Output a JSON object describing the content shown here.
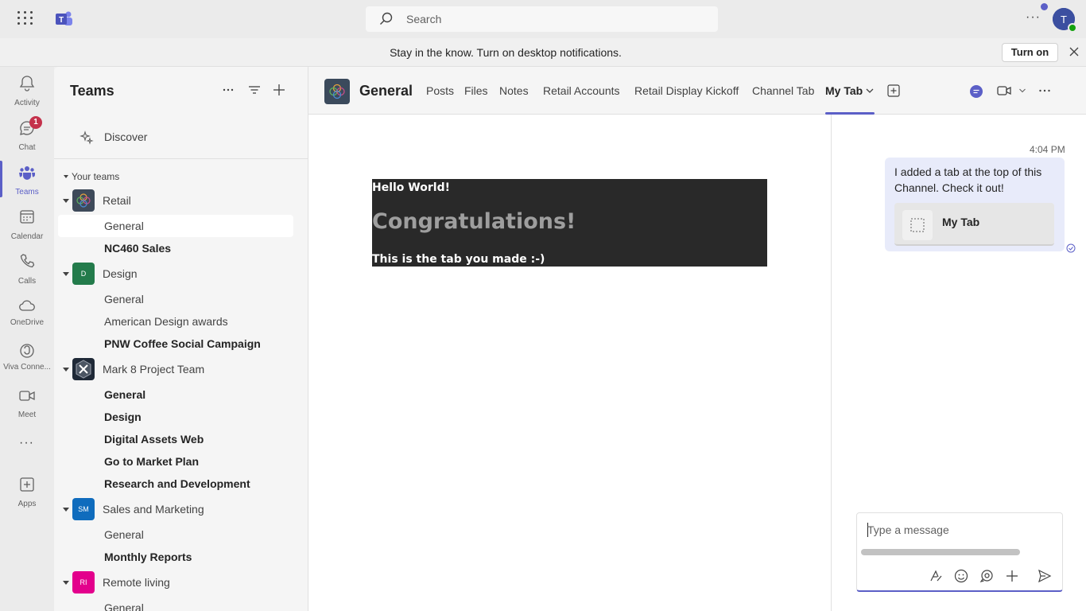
{
  "topbar": {
    "search_placeholder": "Search"
  },
  "banner": {
    "message": "Stay in the know. Turn on desktop notifications.",
    "turn_on_label": "Turn on"
  },
  "rail": {
    "items": [
      {
        "label": "Activity",
        "icon": "bell-icon"
      },
      {
        "label": "Chat",
        "icon": "chat-icon",
        "badge": "1"
      },
      {
        "label": "Teams",
        "icon": "teams-icon",
        "active": true
      },
      {
        "label": "Calendar",
        "icon": "calendar-icon"
      },
      {
        "label": "Calls",
        "icon": "phone-icon"
      },
      {
        "label": "OneDrive",
        "icon": "cloud-icon"
      },
      {
        "label": "Viva Conne...",
        "icon": "viva-connections-icon"
      },
      {
        "label": "Meet",
        "icon": "video-icon"
      },
      {
        "label": "Apps",
        "icon": "add-app-icon"
      }
    ]
  },
  "panel": {
    "title": "Teams",
    "discover": "Discover",
    "section": "Your teams",
    "teams": [
      {
        "name": "Retail",
        "avatar": "",
        "color": "#4a5568",
        "channels": [
          {
            "name": "General",
            "bold": false,
            "selected": true
          },
          {
            "name": "NC460 Sales",
            "bold": true
          }
        ]
      },
      {
        "name": "Design",
        "avatar": "D",
        "color": "#237b4b",
        "channels": [
          {
            "name": "General",
            "bold": false
          },
          {
            "name": "American Design awards",
            "bold": false
          },
          {
            "name": "PNW Coffee Social Campaign",
            "bold": true
          }
        ]
      },
      {
        "name": "Mark 8 Project Team",
        "avatar": "",
        "color": "#1f2937",
        "channels": [
          {
            "name": "General",
            "bold": true
          },
          {
            "name": "Design",
            "bold": true
          },
          {
            "name": "Digital Assets Web",
            "bold": true
          },
          {
            "name": "Go to Market Plan",
            "bold": true
          },
          {
            "name": "Research and Development",
            "bold": true
          }
        ]
      },
      {
        "name": "Sales and Marketing",
        "avatar": "SM",
        "color": "#0f6cbd",
        "channels": [
          {
            "name": "General",
            "bold": false
          },
          {
            "name": "Monthly Reports",
            "bold": true
          }
        ]
      },
      {
        "name": "Remote living",
        "avatar": "RI",
        "color": "#e3008c",
        "channels": [
          {
            "name": "General",
            "bold": false
          }
        ]
      }
    ]
  },
  "channel": {
    "title": "General",
    "tabs": [
      "Posts",
      "Files",
      "Notes",
      "Retail Accounts",
      "Retail Display Kickoff",
      "Channel Tab",
      "My Tab"
    ],
    "active_tab": "My Tab"
  },
  "tab_content": {
    "hello": "Hello World!",
    "congrats": "Congratulations!",
    "made": "This is the tab you made :-)"
  },
  "chat": {
    "time": "4:04 PM",
    "message": "I added a tab at the top of this Channel. Check it out!",
    "card_title": "My Tab",
    "compose_placeholder": "Type a message"
  },
  "colors": {
    "accent": "#5b5fc7",
    "badge": "#c4314b"
  }
}
